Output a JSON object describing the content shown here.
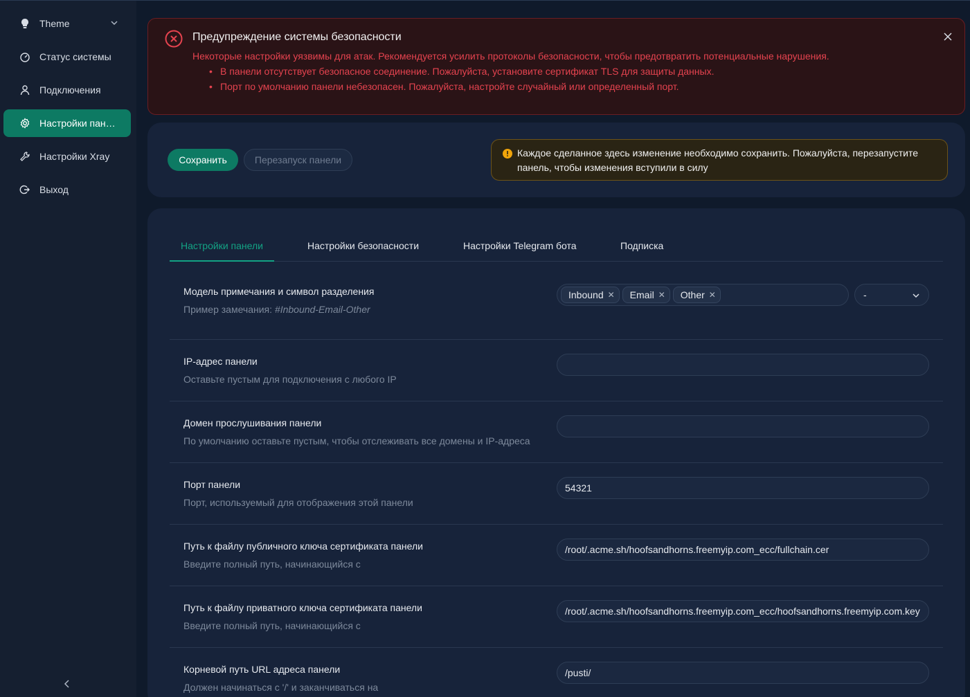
{
  "sidebar": {
    "items": [
      {
        "label": "Theme",
        "icon": "bulb-icon"
      },
      {
        "label": "Статус системы",
        "icon": "dashboard-icon"
      },
      {
        "label": "Подключения",
        "icon": "user-icon"
      },
      {
        "label": "Настройки пан…",
        "icon": "gear-icon",
        "active": true
      },
      {
        "label": "Настройки Xray",
        "icon": "tool-icon"
      },
      {
        "label": "Выход",
        "icon": "logout-icon"
      }
    ]
  },
  "alert": {
    "title": "Предупреждение системы безопасности",
    "description": "Некоторые настройки уязвимы для атак. Рекомендуется усилить протоколы безопасности, чтобы предотвратить потенциальные нарушения.",
    "items": [
      "В панели отсутствует безопасное соединение. Пожалуйста, установите сертификат TLS для защиты данных.",
      "Порт по умолчанию панели небезопасен. Пожалуйста, настройте случайный или определенный порт."
    ]
  },
  "actions": {
    "save_label": "Сохранить",
    "restart_label": "Перезапуск панели",
    "warning_line1": "Каждое сделанное здесь изменение необходимо сохранить. Пожалуйста, перезапустите",
    "warning_line2": "панель, чтобы изменения вступили в силу"
  },
  "tabs": [
    {
      "label": "Настройки панели",
      "active": true
    },
    {
      "label": "Настройки безопасности"
    },
    {
      "label": "Настройки Telegram бота"
    },
    {
      "label": "Подписка"
    }
  ],
  "settings": {
    "remark": {
      "label": "Модель примечания и символ разделения",
      "hint_prefix": "Пример замечания: ",
      "hint_example": "#Inbound-Email-Other",
      "tags": [
        "Inbound",
        "Email",
        "Other"
      ],
      "separator": "-"
    },
    "ip": {
      "label": "IP-адрес панели",
      "hint": "Оставьте пустым для подключения с любого IP",
      "value": ""
    },
    "domain": {
      "label": "Домен прослушивания панели",
      "hint": "По умолчанию оставьте пустым, чтобы отслеживать все домены и IP-адреса",
      "value": ""
    },
    "port": {
      "label": "Порт панели",
      "hint": "Порт, используемый для отображения этой панели",
      "value": "54321"
    },
    "cert": {
      "label": "Путь к файлу публичного ключа сертификата панели",
      "hint": "Введите полный путь, начинающийся с",
      "value": "/root/.acme.sh/hoofsandhorns.freemyip.com_ecc/fullchain.cer"
    },
    "key": {
      "label": "Путь к файлу приватного ключа сертификата панели",
      "hint": "Введите полный путь, начинающийся с",
      "value": "/root/.acme.sh/hoofsandhorns.freemyip.com_ecc/hoofsandhorns.freemyip.com.key"
    },
    "basepath": {
      "label": "Корневой путь URL адреса панели",
      "hint": "Должен начинаться с '/' и заканчиваться на",
      "value": "/pusti/"
    }
  },
  "colors": {
    "accent": "#0d7a63",
    "accent_text": "#13a384",
    "danger": "#e5434f",
    "warning": "#f0a40a"
  }
}
